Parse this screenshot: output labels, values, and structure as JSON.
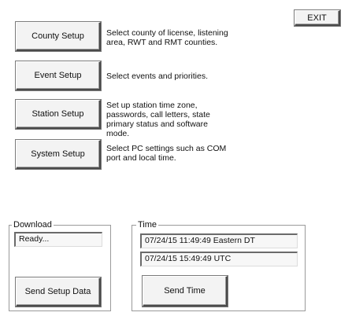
{
  "exit_label": "EXIT",
  "setup_items": [
    {
      "button_label": "County Setup",
      "description": "Select county of license, listening area, RWT and RMT counties."
    },
    {
      "button_label": "Event Setup",
      "description": "Select events and priorities."
    },
    {
      "button_label": "Station Setup",
      "description": "Set up station time zone, passwords, call letters, state primary status and software mode."
    },
    {
      "button_label": "System Setup",
      "description": "Select PC settings such as COM port and local time."
    }
  ],
  "download": {
    "label": "Download",
    "status": "Ready...",
    "button_label": "Send Setup Data"
  },
  "time": {
    "label": "Time",
    "local_time": "07/24/15 11:49:49  Eastern DT",
    "utc_time": "07/24/15 15:49:49  UTC",
    "button_label": "Send Time"
  }
}
